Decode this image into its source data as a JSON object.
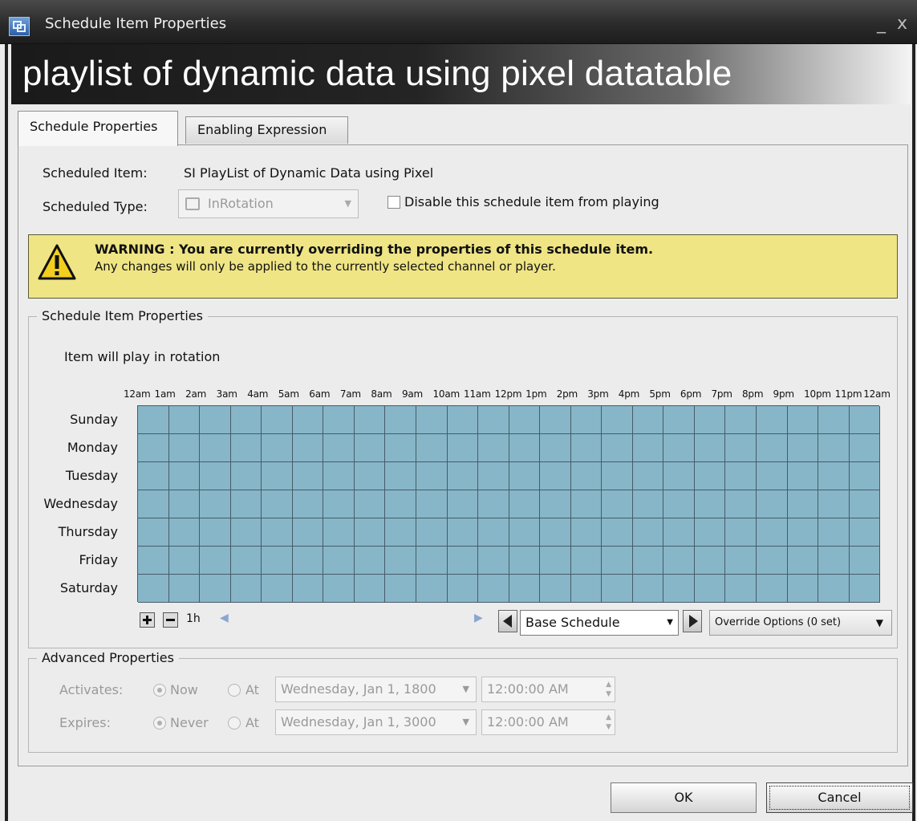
{
  "window": {
    "title": "Schedule Item Properties",
    "min_glyph": "_",
    "close_glyph": "x"
  },
  "banner": {
    "title": "playlist of dynamic data using pixel datatable"
  },
  "tabs": [
    {
      "label": "Schedule Properties",
      "active": true
    },
    {
      "label": "Enabling Expression",
      "active": false
    }
  ],
  "schedule": {
    "item_label": "Scheduled Item:",
    "item_value": "SI PlayList of Dynamic Data using Pixel",
    "type_label": "Scheduled Type:",
    "type_value": "InRotation",
    "disable_label": "Disable this schedule item from playing",
    "disable_checked": false
  },
  "warning": {
    "title": "WARNING : You are currently overriding the properties of this schedule item.",
    "text": "Any changes will only be applied to the currently selected channel or player."
  },
  "item_props": {
    "legend": "Schedule Item Properties",
    "rotation_text": "Item will play in rotation",
    "hours": [
      "12am",
      "1am",
      "2am",
      "3am",
      "4am",
      "5am",
      "6am",
      "7am",
      "8am",
      "9am",
      "10am",
      "11am",
      "12pm",
      "1pm",
      "2pm",
      "3pm",
      "4pm",
      "5pm",
      "6pm",
      "7pm",
      "8pm",
      "9pm",
      "10pm",
      "11pm",
      "12am"
    ],
    "days": [
      "Sunday",
      "Monday",
      "Tuesday",
      "Wednesday",
      "Thursday",
      "Friday",
      "Saturday"
    ],
    "cell_color": "#87b6c8",
    "zoom_label": "1h",
    "schedule_select": "Base Schedule",
    "override_select": "Override Options (0 set)"
  },
  "advanced": {
    "legend": "Advanced Properties",
    "activates_label": "Activates:",
    "activates_now": "Now",
    "activates_at": "At",
    "activates_date": "Wednesday, Jan 1, 1800",
    "activates_time": "12:00:00 AM",
    "expires_label": "Expires:",
    "expires_never": "Never",
    "expires_at": "At",
    "expires_date": "Wednesday, Jan 1, 3000",
    "expires_time": "12:00:00 AM"
  },
  "buttons": {
    "ok": "OK",
    "cancel": "Cancel"
  }
}
